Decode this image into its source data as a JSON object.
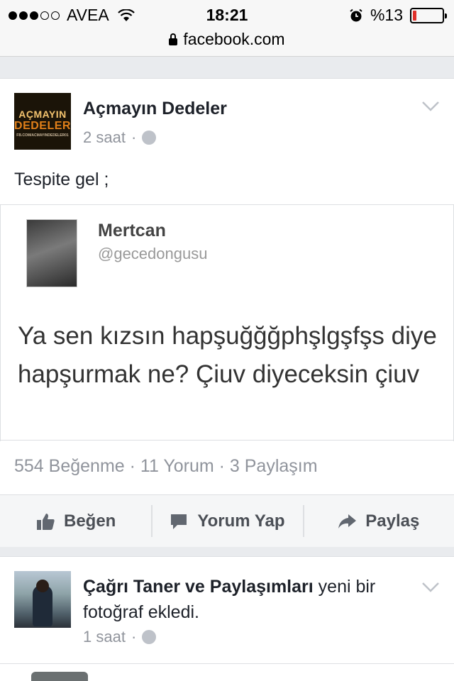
{
  "status_bar": {
    "carrier": "AVEA",
    "signal_strength": 3,
    "signal_max": 5,
    "time": "18:21",
    "battery_percent": "%13",
    "battery_level": 0.13,
    "battery_color": "#e0302a"
  },
  "browser": {
    "url": "facebook.com"
  },
  "post": {
    "page_name": "Açmayın Dedeler",
    "avatar_text": {
      "line1": "AÇMAYIN",
      "line2": "DEDELER",
      "line3": "FB.COM/ACMAYINDEDELER01"
    },
    "time": "2 saat",
    "separator": "·",
    "text": "Tespite gel ;",
    "embedded_tweet": {
      "name": "Mertcan",
      "handle": "@gecedongusu",
      "body": "Ya sen kızsın hapşuğğğphşlgşfşs diye hapşurmak ne? Çiuv diyeceksin çiuv"
    },
    "stats": "554 Beğenme · 11 Yorum · 3 Paylaşım",
    "actions": {
      "like": "Beğen",
      "comment": "Yorum Yap",
      "share": "Paylaş"
    }
  },
  "post2": {
    "author": "Çağrı Taner ve Paylaşımları",
    "action_text": " yeni bir fotoğraf ekledi.",
    "time": "1 saat",
    "separator": "·"
  },
  "icons": [
    "wifi-icon",
    "alarm-icon",
    "battery-icon",
    "lock-icon",
    "globe-icon",
    "chevron-down-icon",
    "like-icon",
    "comment-icon",
    "share-icon"
  ],
  "colors": {
    "page_bg": "#e9ebee",
    "name_text": "#1d2129",
    "meta_text": "#90949c",
    "action_text": "#4b4f56"
  }
}
